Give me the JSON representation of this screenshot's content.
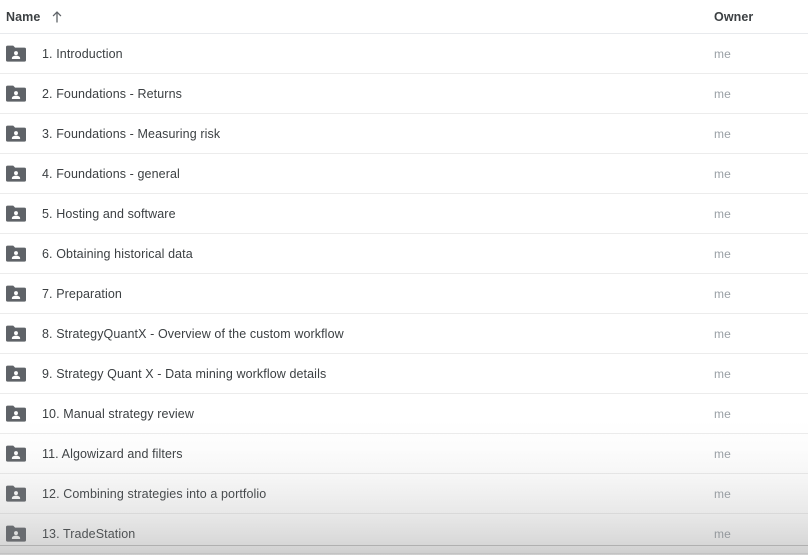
{
  "header": {
    "name_label": "Name",
    "owner_label": "Owner",
    "sort_icon": "sort-ascending-arrow-icon",
    "sort_direction": "ascending"
  },
  "colors": {
    "page_background": "#ffffff",
    "row_divider": "#ececec",
    "header_divider": "#e8eaed",
    "primary_text": "#3c4043",
    "secondary_text": "#9aa0a6",
    "folder_icon": "#5f6368"
  },
  "rows": [
    {
      "icon": "shared-folder-icon",
      "name": "1. Introduction",
      "owner": "me"
    },
    {
      "icon": "shared-folder-icon",
      "name": "2. Foundations - Returns",
      "owner": "me"
    },
    {
      "icon": "shared-folder-icon",
      "name": "3. Foundations - Measuring risk",
      "owner": "me"
    },
    {
      "icon": "shared-folder-icon",
      "name": "4. Foundations - general",
      "owner": "me"
    },
    {
      "icon": "shared-folder-icon",
      "name": "5. Hosting and software",
      "owner": "me"
    },
    {
      "icon": "shared-folder-icon",
      "name": "6. Obtaining historical data",
      "owner": "me"
    },
    {
      "icon": "shared-folder-icon",
      "name": "7. Preparation",
      "owner": "me"
    },
    {
      "icon": "shared-folder-icon",
      "name": "8. StrategyQuantX - Overview of the custom workflow",
      "owner": "me"
    },
    {
      "icon": "shared-folder-icon",
      "name": "9. Strategy Quant X - Data mining workflow details",
      "owner": "me"
    },
    {
      "icon": "shared-folder-icon",
      "name": "10. Manual strategy review",
      "owner": "me"
    },
    {
      "icon": "shared-folder-icon",
      "name": "11. Algowizard and filters",
      "owner": "me"
    },
    {
      "icon": "shared-folder-icon",
      "name": "12. Combining strategies into a portfolio",
      "owner": "me"
    },
    {
      "icon": "shared-folder-icon",
      "name": "13. TradeStation",
      "owner": "me"
    }
  ]
}
